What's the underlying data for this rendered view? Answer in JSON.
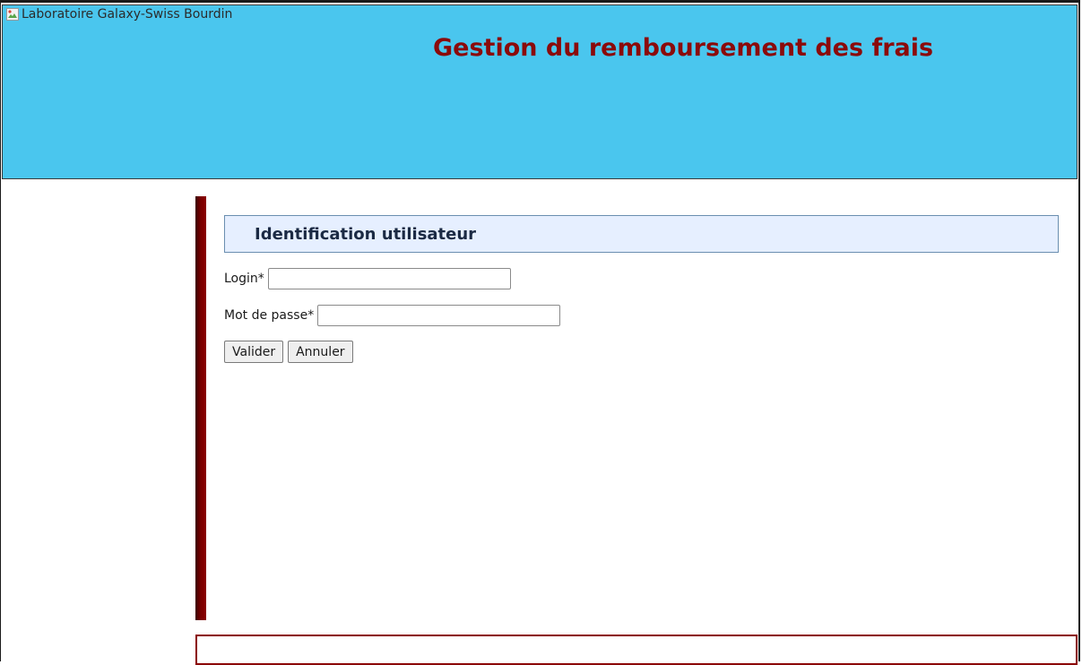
{
  "header": {
    "logo_alt": "Laboratoire Galaxy-Swiss Bourdin",
    "title": "Gestion du remboursement des frais",
    "background_color": "#4ac6ee",
    "title_color": "#8b0a0a"
  },
  "login_form": {
    "heading": "Identification utilisateur",
    "login_label": "Login*",
    "login_value": "",
    "password_label": "Mot de passe*",
    "password_value": "",
    "submit_label": "Valider",
    "cancel_label": "Annuler"
  },
  "colors": {
    "accent_bar": "#8b0000",
    "heading_background": "#e6efff"
  },
  "icons": {
    "logo": "broken-image-icon"
  }
}
